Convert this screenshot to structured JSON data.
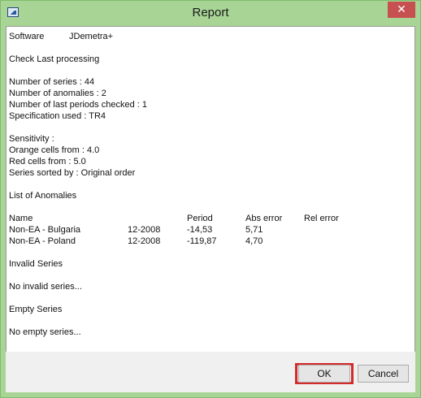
{
  "window": {
    "title": "Report",
    "close_glyph": "✕",
    "close_icon": "close-icon",
    "app_icon": "app-window-icon"
  },
  "report": {
    "software_label": "Software",
    "software_value": "JDemetra+",
    "check": "Check Last processing",
    "num_series": "Number of series : 44",
    "num_anomalies": "Number of anomalies : 2",
    "periods_checked": "Number of last periods checked : 1",
    "specification": "Specification used : TR4",
    "sensitivity": "Sensitivity :",
    "orange": "Orange cells from : 4.0",
    "red": "Red cells from : 5.0",
    "sorted": "Series sorted by : Original order",
    "anomalies_title": "List of Anomalies",
    "headers": {
      "name": "Name",
      "period": "Period",
      "abs_error": "Abs error",
      "rel_error": "Rel error"
    },
    "rows": [
      {
        "name": "Non-EA - Bulgaria",
        "date": "12-2008",
        "period": "-14,53",
        "abs": "5,71"
      },
      {
        "name": "Non-EA - Poland",
        "date": "12-2008",
        "period": "-119,87",
        "abs": "4,70"
      }
    ],
    "invalid_title": "Invalid Series",
    "invalid_text": "No invalid series...",
    "empty_title": "Empty Series",
    "empty_text": "No empty series..."
  },
  "buttons": {
    "ok": "OK",
    "cancel": "Cancel"
  },
  "colors": {
    "titlebar": "#a8d496",
    "close": "#c75050",
    "highlight": "#d42a2a"
  }
}
